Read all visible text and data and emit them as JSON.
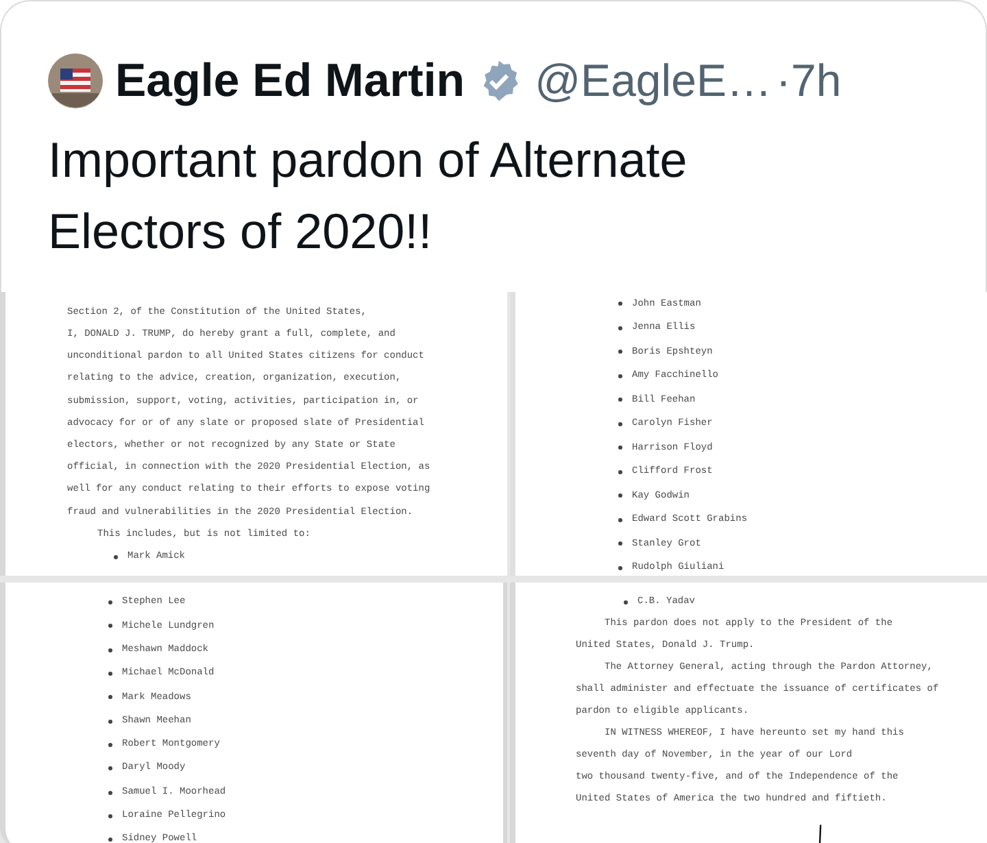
{
  "post": {
    "author": "Eagle Ed Martin",
    "verified": true,
    "handle": "@EagleE…",
    "time": "·7h",
    "text": "Important pardon of Alternate Electors of 2020!!"
  },
  "document_pages": [
    {
      "lines": [
        {
          "kind": "text",
          "text": "Section 2, of the Constitution of the United States,"
        },
        {
          "kind": "text",
          "text": "I, DONALD J. TRUMP, do hereby grant a full, complete, and"
        },
        {
          "kind": "text",
          "text": "unconditional pardon to all United States citizens for conduct"
        },
        {
          "kind": "text",
          "text": "relating to the advice, creation, organization, execution,"
        },
        {
          "kind": "text",
          "text": "submission, support, voting, activities, participation in, or"
        },
        {
          "kind": "text",
          "text": "advocacy for or of any slate or proposed slate of Presidential"
        },
        {
          "kind": "text",
          "text": "electors, whether or not recognized by any State or State"
        },
        {
          "kind": "text",
          "text": "official, in connection with the 2020 Presidential Election, as"
        },
        {
          "kind": "text",
          "text": "well for any conduct relating to their efforts to expose voting"
        },
        {
          "kind": "text",
          "text": "fraud and vulnerabilities in the 2020 Presidential Election."
        },
        {
          "kind": "indent",
          "text": "This includes, but is not limited to:"
        },
        {
          "kind": "bullet",
          "text": "Mark Amick"
        }
      ]
    },
    {
      "lines": [
        {
          "kind": "bullet",
          "text": "John Eastman"
        },
        {
          "kind": "bullet",
          "text": "Jenna Ellis"
        },
        {
          "kind": "bullet",
          "text": "Boris Epshteyn"
        },
        {
          "kind": "bullet",
          "text": "Amy Facchinello"
        },
        {
          "kind": "bullet",
          "text": "Bill Feehan"
        },
        {
          "kind": "bullet",
          "text": "Carolyn Fisher"
        },
        {
          "kind": "bullet",
          "text": "Harrison Floyd"
        },
        {
          "kind": "bullet",
          "text": "Clifford Frost"
        },
        {
          "kind": "bullet",
          "text": "Kay Godwin"
        },
        {
          "kind": "bullet",
          "text": "Edward Scott Grabins"
        },
        {
          "kind": "bullet",
          "text": "Stanley Grot"
        },
        {
          "kind": "bullet",
          "text": "Rudolph Giuliani"
        }
      ]
    },
    {
      "lines": [
        {
          "kind": "bullet",
          "text": "Stephen Lee"
        },
        {
          "kind": "bullet",
          "text": "Michele Lundgren"
        },
        {
          "kind": "bullet",
          "text": "Meshawn Maddock"
        },
        {
          "kind": "bullet",
          "text": "Michael McDonald"
        },
        {
          "kind": "bullet",
          "text": "Mark Meadows"
        },
        {
          "kind": "bullet",
          "text": "Shawn Meehan"
        },
        {
          "kind": "bullet",
          "text": "Robert Montgomery"
        },
        {
          "kind": "bullet",
          "text": "Daryl Moody"
        },
        {
          "kind": "bullet",
          "text": "Samuel I. Moorhead"
        },
        {
          "kind": "bullet",
          "text": "Loraine Pellegrino"
        },
        {
          "kind": "bullet",
          "text": "Sidney Powell"
        }
      ]
    },
    {
      "signed": true,
      "lines": [
        {
          "kind": "bullet",
          "text": "C.B. Yadav"
        },
        {
          "kind": "indent",
          "text": "This pardon does not apply to the President of the"
        },
        {
          "kind": "text",
          "text": "United States, Donald J. Trump."
        },
        {
          "kind": "indent",
          "text": "The Attorney General, acting through the Pardon Attorney,"
        },
        {
          "kind": "text",
          "text": "shall administer and effectuate the issuance of certificates of"
        },
        {
          "kind": "text",
          "text": "pardon to eligible applicants."
        },
        {
          "kind": "indent",
          "text": "IN WITNESS WHEREOF, I have hereunto set my hand this"
        },
        {
          "kind": "text",
          "text": "seventh day of November, in the year of our Lord"
        },
        {
          "kind": "text",
          "text": "two thousand twenty-five, and of the Independence of the"
        },
        {
          "kind": "text",
          "text": "United States of America the two hundred and fiftieth."
        }
      ]
    }
  ]
}
